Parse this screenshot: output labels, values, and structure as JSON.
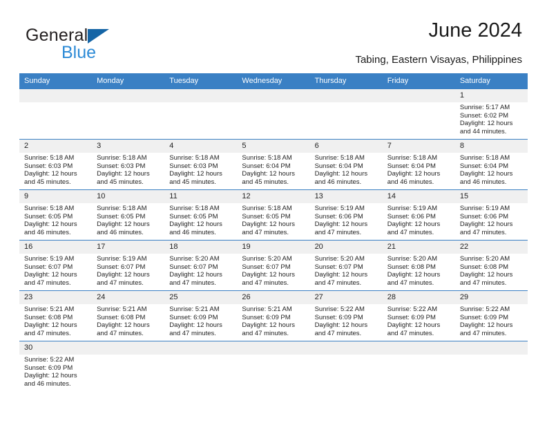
{
  "brand": {
    "name_part1": "General",
    "name_part2": "Blue",
    "triangle_color": "#1565a6",
    "blue_color": "#2c8ad6"
  },
  "header": {
    "title": "June 2024",
    "subtitle": "Tabing, Eastern Visayas, Philippines"
  },
  "colors": {
    "header_band": "#3a80c4",
    "day_number_band": "#f0f0f0",
    "text": "#222222"
  },
  "calendar": {
    "weekday_headers": [
      "Sunday",
      "Monday",
      "Tuesday",
      "Wednesday",
      "Thursday",
      "Friday",
      "Saturday"
    ],
    "weeks": [
      [
        {
          "blank": true
        },
        {
          "blank": true
        },
        {
          "blank": true
        },
        {
          "blank": true
        },
        {
          "blank": true
        },
        {
          "blank": true
        },
        {
          "day": "1",
          "sunrise": "Sunrise: 5:17 AM",
          "sunset": "Sunset: 6:02 PM",
          "daylight": "Daylight: 12 hours and 44 minutes."
        }
      ],
      [
        {
          "day": "2",
          "sunrise": "Sunrise: 5:18 AM",
          "sunset": "Sunset: 6:03 PM",
          "daylight": "Daylight: 12 hours and 45 minutes."
        },
        {
          "day": "3",
          "sunrise": "Sunrise: 5:18 AM",
          "sunset": "Sunset: 6:03 PM",
          "daylight": "Daylight: 12 hours and 45 minutes."
        },
        {
          "day": "4",
          "sunrise": "Sunrise: 5:18 AM",
          "sunset": "Sunset: 6:03 PM",
          "daylight": "Daylight: 12 hours and 45 minutes."
        },
        {
          "day": "5",
          "sunrise": "Sunrise: 5:18 AM",
          "sunset": "Sunset: 6:04 PM",
          "daylight": "Daylight: 12 hours and 45 minutes."
        },
        {
          "day": "6",
          "sunrise": "Sunrise: 5:18 AM",
          "sunset": "Sunset: 6:04 PM",
          "daylight": "Daylight: 12 hours and 46 minutes."
        },
        {
          "day": "7",
          "sunrise": "Sunrise: 5:18 AM",
          "sunset": "Sunset: 6:04 PM",
          "daylight": "Daylight: 12 hours and 46 minutes."
        },
        {
          "day": "8",
          "sunrise": "Sunrise: 5:18 AM",
          "sunset": "Sunset: 6:04 PM",
          "daylight": "Daylight: 12 hours and 46 minutes."
        }
      ],
      [
        {
          "day": "9",
          "sunrise": "Sunrise: 5:18 AM",
          "sunset": "Sunset: 6:05 PM",
          "daylight": "Daylight: 12 hours and 46 minutes."
        },
        {
          "day": "10",
          "sunrise": "Sunrise: 5:18 AM",
          "sunset": "Sunset: 6:05 PM",
          "daylight": "Daylight: 12 hours and 46 minutes."
        },
        {
          "day": "11",
          "sunrise": "Sunrise: 5:18 AM",
          "sunset": "Sunset: 6:05 PM",
          "daylight": "Daylight: 12 hours and 46 minutes."
        },
        {
          "day": "12",
          "sunrise": "Sunrise: 5:18 AM",
          "sunset": "Sunset: 6:05 PM",
          "daylight": "Daylight: 12 hours and 47 minutes."
        },
        {
          "day": "13",
          "sunrise": "Sunrise: 5:19 AM",
          "sunset": "Sunset: 6:06 PM",
          "daylight": "Daylight: 12 hours and 47 minutes."
        },
        {
          "day": "14",
          "sunrise": "Sunrise: 5:19 AM",
          "sunset": "Sunset: 6:06 PM",
          "daylight": "Daylight: 12 hours and 47 minutes."
        },
        {
          "day": "15",
          "sunrise": "Sunrise: 5:19 AM",
          "sunset": "Sunset: 6:06 PM",
          "daylight": "Daylight: 12 hours and 47 minutes."
        }
      ],
      [
        {
          "day": "16",
          "sunrise": "Sunrise: 5:19 AM",
          "sunset": "Sunset: 6:07 PM",
          "daylight": "Daylight: 12 hours and 47 minutes."
        },
        {
          "day": "17",
          "sunrise": "Sunrise: 5:19 AM",
          "sunset": "Sunset: 6:07 PM",
          "daylight": "Daylight: 12 hours and 47 minutes."
        },
        {
          "day": "18",
          "sunrise": "Sunrise: 5:20 AM",
          "sunset": "Sunset: 6:07 PM",
          "daylight": "Daylight: 12 hours and 47 minutes."
        },
        {
          "day": "19",
          "sunrise": "Sunrise: 5:20 AM",
          "sunset": "Sunset: 6:07 PM",
          "daylight": "Daylight: 12 hours and 47 minutes."
        },
        {
          "day": "20",
          "sunrise": "Sunrise: 5:20 AM",
          "sunset": "Sunset: 6:07 PM",
          "daylight": "Daylight: 12 hours and 47 minutes."
        },
        {
          "day": "21",
          "sunrise": "Sunrise: 5:20 AM",
          "sunset": "Sunset: 6:08 PM",
          "daylight": "Daylight: 12 hours and 47 minutes."
        },
        {
          "day": "22",
          "sunrise": "Sunrise: 5:20 AM",
          "sunset": "Sunset: 6:08 PM",
          "daylight": "Daylight: 12 hours and 47 minutes."
        }
      ],
      [
        {
          "day": "23",
          "sunrise": "Sunrise: 5:21 AM",
          "sunset": "Sunset: 6:08 PM",
          "daylight": "Daylight: 12 hours and 47 minutes."
        },
        {
          "day": "24",
          "sunrise": "Sunrise: 5:21 AM",
          "sunset": "Sunset: 6:08 PM",
          "daylight": "Daylight: 12 hours and 47 minutes."
        },
        {
          "day": "25",
          "sunrise": "Sunrise: 5:21 AM",
          "sunset": "Sunset: 6:09 PM",
          "daylight": "Daylight: 12 hours and 47 minutes."
        },
        {
          "day": "26",
          "sunrise": "Sunrise: 5:21 AM",
          "sunset": "Sunset: 6:09 PM",
          "daylight": "Daylight: 12 hours and 47 minutes."
        },
        {
          "day": "27",
          "sunrise": "Sunrise: 5:22 AM",
          "sunset": "Sunset: 6:09 PM",
          "daylight": "Daylight: 12 hours and 47 minutes."
        },
        {
          "day": "28",
          "sunrise": "Sunrise: 5:22 AM",
          "sunset": "Sunset: 6:09 PM",
          "daylight": "Daylight: 12 hours and 47 minutes."
        },
        {
          "day": "29",
          "sunrise": "Sunrise: 5:22 AM",
          "sunset": "Sunset: 6:09 PM",
          "daylight": "Daylight: 12 hours and 47 minutes."
        }
      ],
      [
        {
          "day": "30",
          "sunrise": "Sunrise: 5:22 AM",
          "sunset": "Sunset: 6:09 PM",
          "daylight": "Daylight: 12 hours and 46 minutes."
        },
        {
          "blank": true
        },
        {
          "blank": true
        },
        {
          "blank": true
        },
        {
          "blank": true
        },
        {
          "blank": true
        },
        {
          "blank": true
        }
      ]
    ]
  }
}
